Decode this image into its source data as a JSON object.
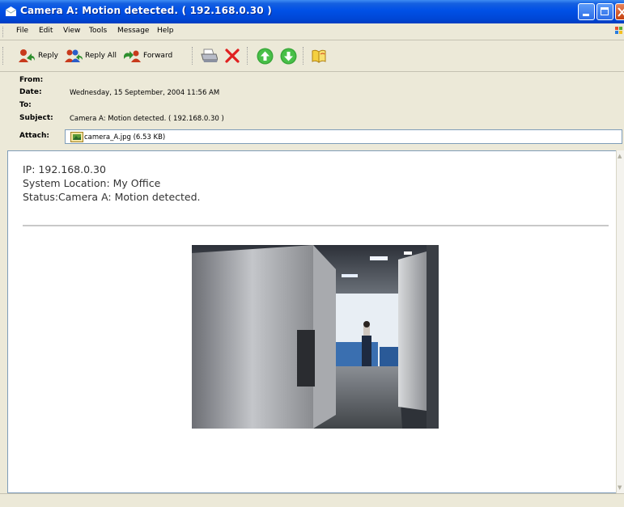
{
  "window": {
    "title": "Camera A: Motion detected. ( 192.168.0.30 )"
  },
  "menu": {
    "items": [
      "File",
      "Edit",
      "View",
      "Tools",
      "Message",
      "Help"
    ]
  },
  "toolbar": {
    "reply_label": "Reply",
    "reply_all_label": "Reply All",
    "forward_label": "Forward",
    "icons": [
      "reply-icon",
      "reply-all-icon",
      "forward-icon",
      "print-icon",
      "delete-icon",
      "previous-icon",
      "next-icon",
      "addresses-icon"
    ]
  },
  "header": {
    "from_label": "From:",
    "from_value": "",
    "date_label": "Date:",
    "date_value": "Wednesday, 15 September, 2004 11:56 AM",
    "to_label": "To:",
    "to_value": "",
    "subject_label": "Subject:",
    "subject_value": "Camera A: Motion detected. ( 192.168.0.30 )",
    "attach_label": "Attach:",
    "attachment": "camera_A.jpg (6.53 KB)"
  },
  "message": {
    "line1": "IP: 192.168.0.30",
    "line2": "System Location: My Office",
    "line3": "Status:Camera A: Motion detected."
  },
  "colors": {
    "titlebar": "#0050e6",
    "chrome": "#ece9d8",
    "close_button": "#d5562a"
  }
}
